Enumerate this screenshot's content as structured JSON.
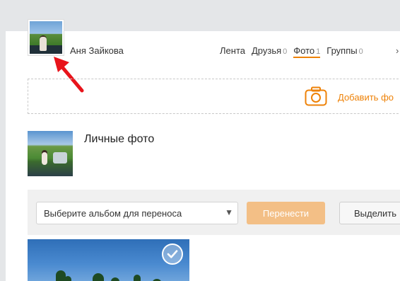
{
  "profile": {
    "user_name": "Аня Зайкова"
  },
  "nav": {
    "items": [
      {
        "label": "Лента",
        "count": ""
      },
      {
        "label": "Друзья",
        "count": "0"
      },
      {
        "label": "Фото",
        "count": "1"
      },
      {
        "label": "Группы",
        "count": "0"
      }
    ],
    "active_index": 2
  },
  "add_photo": {
    "label": "Добавить фо"
  },
  "album": {
    "title": "Личные фото"
  },
  "toolbar": {
    "album_select_placeholder": "Выберите альбом для переноса",
    "move_label": "Перенести",
    "select_all_label": "Выделить"
  },
  "colors": {
    "accent": "#ee8208",
    "move_button_bg": "#f3bf86",
    "annotation_arrow": "#e8141b"
  }
}
